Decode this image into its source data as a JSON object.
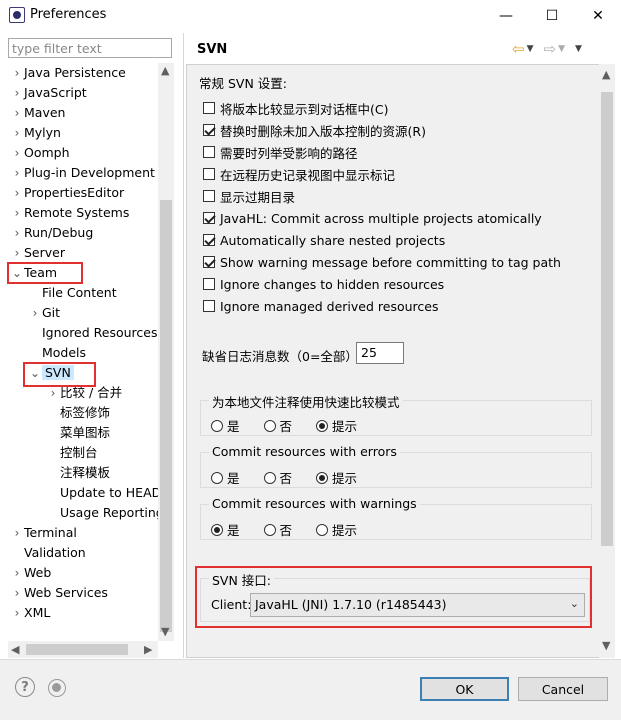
{
  "window": {
    "title": "Preferences",
    "minimize_glyph": "—",
    "maximize_glyph": "☐",
    "close_glyph": "✕"
  },
  "filter": {
    "placeholder": "type filter text"
  },
  "tree": {
    "items": [
      {
        "label": "Java Persistence",
        "twisty": "›",
        "indent": 0
      },
      {
        "label": "JavaScript",
        "twisty": "›",
        "indent": 0
      },
      {
        "label": "Maven",
        "twisty": "›",
        "indent": 0
      },
      {
        "label": "Mylyn",
        "twisty": "›",
        "indent": 0
      },
      {
        "label": "Oomph",
        "twisty": "›",
        "indent": 0
      },
      {
        "label": "Plug-in Development",
        "twisty": "›",
        "indent": 0
      },
      {
        "label": "PropertiesEditor",
        "twisty": "›",
        "indent": 0
      },
      {
        "label": "Remote Systems",
        "twisty": "›",
        "indent": 0
      },
      {
        "label": "Run/Debug",
        "twisty": "›",
        "indent": 0
      },
      {
        "label": "Server",
        "twisty": "›",
        "indent": 0
      },
      {
        "label": "Team",
        "twisty": "⌄",
        "indent": 0
      },
      {
        "label": "File Content",
        "twisty": "",
        "indent": 1
      },
      {
        "label": "Git",
        "twisty": "›",
        "indent": 1
      },
      {
        "label": "Ignored Resources",
        "twisty": "",
        "indent": 1
      },
      {
        "label": "Models",
        "twisty": "",
        "indent": 1
      },
      {
        "label": "SVN",
        "twisty": "⌄",
        "indent": 1
      },
      {
        "label": "比较 / 合并",
        "twisty": "›",
        "indent": 2
      },
      {
        "label": "标签修饰",
        "twisty": "",
        "indent": 2
      },
      {
        "label": "菜单图标",
        "twisty": "",
        "indent": 2
      },
      {
        "label": "控制台",
        "twisty": "",
        "indent": 2
      },
      {
        "label": "注释模板",
        "twisty": "",
        "indent": 2
      },
      {
        "label": "Update to HEAD",
        "twisty": "",
        "indent": 2
      },
      {
        "label": "Usage Reporting",
        "twisty": "",
        "indent": 2
      },
      {
        "label": "Terminal",
        "twisty": "›",
        "indent": 0
      },
      {
        "label": "Validation",
        "twisty": "",
        "indent": 0
      },
      {
        "label": "Web",
        "twisty": "›",
        "indent": 0
      },
      {
        "label": "Web Services",
        "twisty": "›",
        "indent": 0
      },
      {
        "label": "XML",
        "twisty": "›",
        "indent": 0
      }
    ],
    "selected": "SVN"
  },
  "page": {
    "title": "SVN",
    "section_general": "常规 SVN 设置:",
    "checkboxes": [
      {
        "label": "将版本比较显示到对话框中(C)",
        "checked": false
      },
      {
        "label": "替换时删除未加入版本控制的资源(R)",
        "checked": true
      },
      {
        "label": "需要时列举受影响的路径",
        "checked": false
      },
      {
        "label": "在远程历史记录视图中显示标记",
        "checked": false
      },
      {
        "label": "显示过期目录",
        "checked": false
      },
      {
        "label": "JavaHL: Commit across multiple projects atomically",
        "checked": true
      },
      {
        "label": "Automatically share nested projects",
        "checked": true
      },
      {
        "label": "Show warning message before committing to tag path",
        "checked": true
      },
      {
        "label": "Ignore changes to hidden resources",
        "checked": false
      },
      {
        "label": "Ignore managed derived resources",
        "checked": false
      }
    ],
    "log_count_label": "缺省日志消息数（0=全部）",
    "log_count_value": "25",
    "groups": [
      {
        "title": "为本地文件注释使用快速比较模式",
        "options": [
          "是",
          "否",
          "提示"
        ],
        "selected": 2
      },
      {
        "title": "Commit resources with errors",
        "options": [
          "是",
          "否",
          "提示"
        ],
        "selected": 2
      },
      {
        "title": "Commit resources with warnings",
        "options": [
          "是",
          "否",
          "提示"
        ],
        "selected": 0
      }
    ],
    "svn_interface": {
      "title": "SVN 接口:",
      "client_label": "Client:",
      "client_value": "JavaHL (JNI) 1.7.10 (r1485443)"
    }
  },
  "buttons": {
    "ok": "OK",
    "cancel": "Cancel"
  },
  "colors": {
    "highlight_border": "#e03030",
    "selection": "#cce8ff",
    "default_button_border": "#3c7fb1"
  }
}
